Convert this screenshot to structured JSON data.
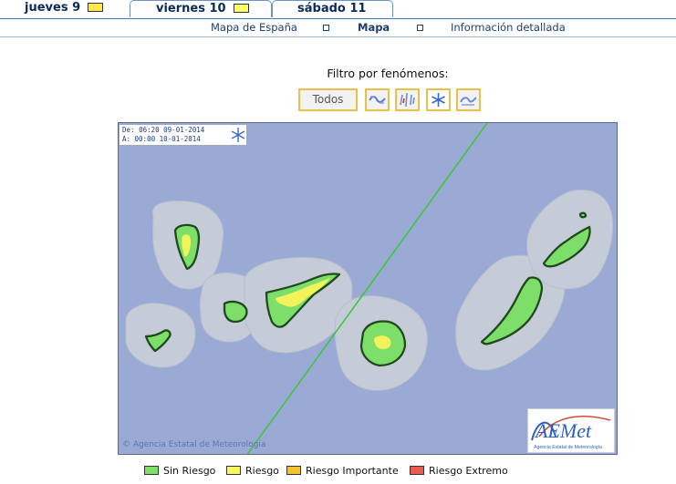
{
  "tabs": [
    {
      "label": "jueves 9",
      "flag_color": "#ffe84a"
    },
    {
      "label": "viernes 10",
      "flag_color": "#ffff66"
    },
    {
      "label": "sábado 11"
    }
  ],
  "subnav": {
    "items": [
      "Mapa de España",
      "Mapa",
      "Información detallada"
    ],
    "current": "Mapa"
  },
  "filter": {
    "title": "Filtro por fenómenos:",
    "buttons": [
      {
        "label": "Todos"
      },
      {
        "icon": "wind-icon"
      },
      {
        "icon": "rain-icon"
      },
      {
        "icon": "snow-icon"
      },
      {
        "icon": "coastal-wave-icon"
      }
    ]
  },
  "map": {
    "valid_from_label": "De:",
    "valid_from": "06:20 09-01-2014",
    "valid_to_label": "A:",
    "valid_to": "00:00 10-01-2014",
    "phenomenon_icon": "snowflake-icon",
    "agency_text": "© Agencia Estatal de Meteorología",
    "logo": {
      "brand": "AEMet",
      "subtitle": "Agencia Estatal de Meteorología"
    },
    "colors": {
      "sea": "#9aaad4",
      "zone": "#c5ccd8",
      "safe": "#7ddf6a",
      "warning": "#f2f25a",
      "border": "#1f4a1f"
    }
  },
  "legend": [
    {
      "label": "Sin Riesgo",
      "color": "#7ddf6a"
    },
    {
      "label": "Riesgo",
      "color": "#f6f660"
    },
    {
      "label": "Riesgo Importante",
      "color": "#f2c230"
    },
    {
      "label": "Riesgo Extremo",
      "color": "#ea5a50"
    }
  ]
}
